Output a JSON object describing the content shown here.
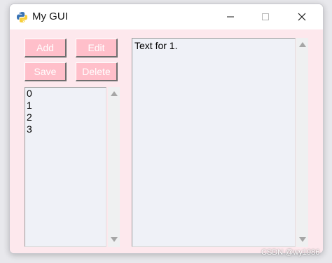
{
  "window": {
    "title": "My GUI",
    "background_color": "#fde8ed",
    "controls": {
      "minimize_icon": "minimize-icon",
      "maximize_icon": "maximize-icon",
      "close_icon": "close-icon"
    }
  },
  "buttons": {
    "add_label": "Add",
    "edit_label": "Edit",
    "save_label": "Save",
    "delete_label": "Delete",
    "color": "#ffbfca"
  },
  "listbox": {
    "items": [
      "0",
      "1",
      "2",
      "3"
    ]
  },
  "textbox": {
    "content": "Text for 1."
  },
  "watermark": "CSDN @wy1986"
}
